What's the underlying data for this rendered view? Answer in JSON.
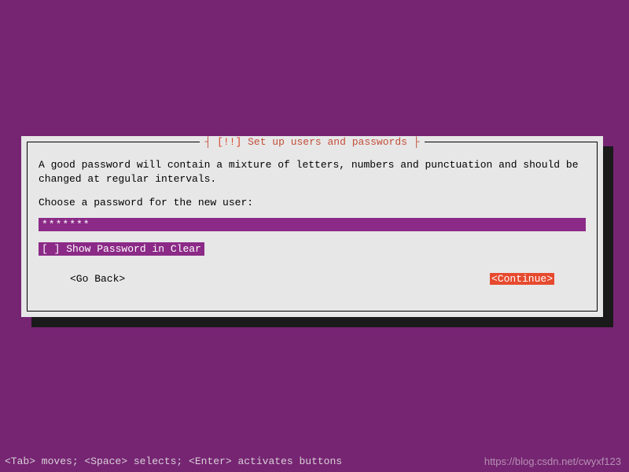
{
  "dialog": {
    "title_prefix": "[!!]",
    "title": "Set up users and passwords",
    "help_text": "A good password will contain a mixture of letters, numbers and punctuation and should be changed at regular intervals.",
    "prompt": "Choose a password for the new user:",
    "password_value": "*******",
    "checkbox": {
      "state": "[ ]",
      "label": "Show Password in Clear"
    },
    "go_back": "<Go Back>",
    "continue": "<Continue>"
  },
  "footer": {
    "hint": "<Tab> moves; <Space> selects; <Enter> activates buttons"
  },
  "watermark": "https://blog.csdn.net/cwyxf123"
}
